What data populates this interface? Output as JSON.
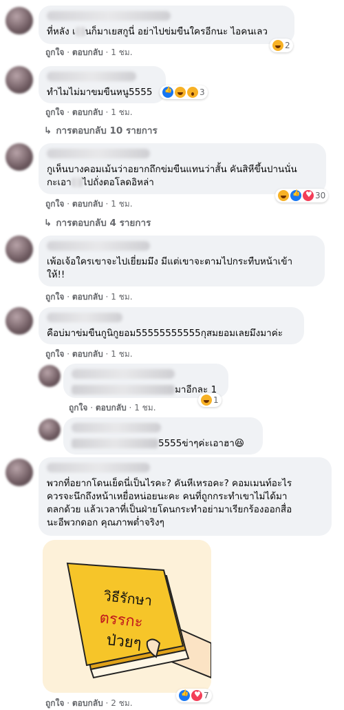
{
  "comments": [
    {
      "text_a": "ที่หลัง เ",
      "text_b": "นก็มาเยสกูนี่ อย่าไปข่มขืนใครอีกนะ ไอคนเลว",
      "reaction_count": "2",
      "like": "ถูกใจ",
      "reply": "ตอบกลับ",
      "time": "1 ชม."
    },
    {
      "text": "ทำไมไม่มาขมขืนหนู5555",
      "reaction_count": "3",
      "like": "ถูกใจ",
      "reply": "ตอบกลับ",
      "time": "1 ชม.",
      "replies_label": "การตอบกลับ 10 รายการ"
    },
    {
      "text_line1": "กูเห็นบางคอมเม้นว่าอยากถึกข่มขืนแทนว่าสั้น คันสิหีขึ้นปานนั่น",
      "text_line2a": "กะเอา",
      "text_line2b": "ไปถั่งตอโลดอิหล่า",
      "reaction_count": "30",
      "like": "ถูกใจ",
      "reply": "ตอบกลับ",
      "time": "1 ชม.",
      "replies_label": "การตอบกลับ 4 รายการ"
    },
    {
      "text": "เพ้อเจ้อใครเขาจะไปเยี่ยมมึง มีแต่เขาจะตามไปกระทืบหน้าเข้า\nให้!!",
      "like": "ถูกใจ",
      "reply": "ตอบกลับ",
      "time": "1 ชม."
    },
    {
      "text": "คือบ่มาข่มขืนกูนิกูยอม55555555555กุสมยอมเลยมึงมาค่ะ",
      "like": "ถูกใจ",
      "reply": "ตอบกลับ",
      "time": "1 ชม."
    }
  ],
  "replies": [
    {
      "text": "มาอีกละ 1",
      "reaction_count": "1",
      "like": "ถูกใจ",
      "reply": "ตอบกลับ",
      "time": "1 ชม."
    },
    {
      "text": "5555ข่าๆค่ะเอาฮา😆"
    }
  ],
  "last_comment": {
    "text": "พวกที่อยากโดนเย็ดนี่เป็นไรคะ? คันหีเหรอคะ? คอมเมนท์อะไร\nควรจะนึกถึงหน้าเหยื่อหน่อยนะคะ คนที่ถูกกระทำเขาไม่ได้มา\nตลกด้วย แล้วเวลาที่เป็นฝ่ายโดนกระทำอย่ามาเรียกร้องออกสื่อ\nนะอีพวกดอก คุณภาพต่ำจริงๆ",
    "book_title_1": "วิธีรักษา",
    "book_title_2": "ตรรกะ",
    "book_title_3": "ป่วยๆ",
    "reaction_count": "7",
    "like": "ถูกใจ",
    "reply": "ตอบกลับ",
    "time": "2 ชม."
  }
}
